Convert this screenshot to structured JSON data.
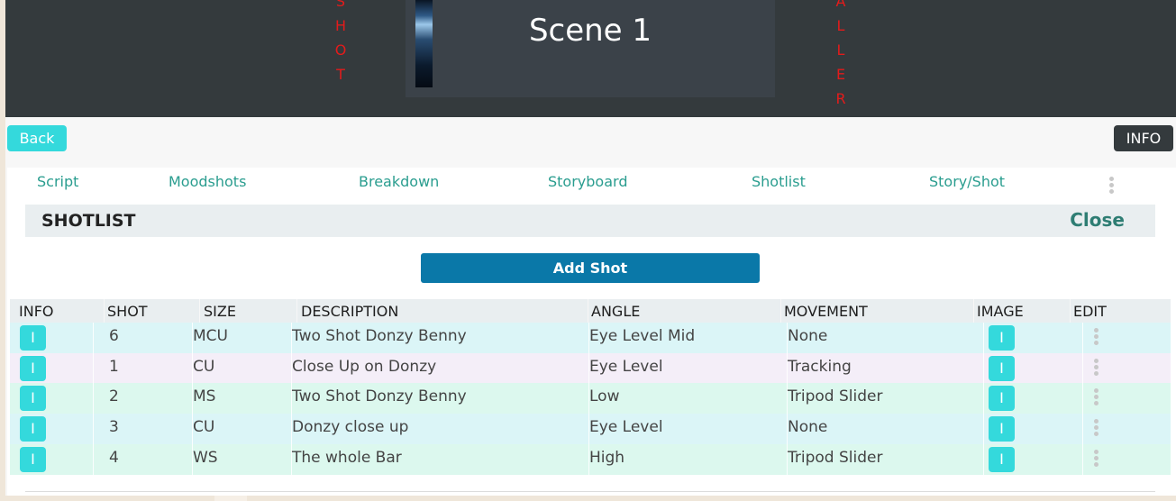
{
  "header": {
    "left_vertical": [
      "S",
      "H",
      "O",
      "T"
    ],
    "right_vertical": [
      "A",
      "L",
      "L",
      "E",
      "R"
    ],
    "scene_title": "Scene 1",
    "accent_text_color": "#e31b1b"
  },
  "toolbar": {
    "back_label": "Back",
    "info_label": "INFO"
  },
  "tabs": [
    "Script",
    "Moodshots",
    "Breakdown",
    "Storyboard",
    "Shotlist",
    "Story/Shot"
  ],
  "panel": {
    "title": "SHOTLIST",
    "close_label": "Close"
  },
  "add_shot_label": "Add Shot",
  "table": {
    "columns": [
      "INFO",
      "SHOT",
      "SIZE",
      "DESCRIPTION",
      "ANGLE",
      "MOVEMENT",
      "IMAGE",
      "EDIT"
    ],
    "info_button_label": "I",
    "image_button_label": "I",
    "rows": [
      {
        "shot": "6",
        "size": "MCU",
        "description": "Two Shot Donzy Benny",
        "angle": "Eye Level Mid",
        "movement": "None",
        "color": "#dbf5f7"
      },
      {
        "shot": "1",
        "size": "CU",
        "description": "Close Up on Donzy",
        "angle": "Eye Level",
        "movement": "Tracking",
        "color": "#f4eef8"
      },
      {
        "shot": "2",
        "size": "MS",
        "description": "Two Shot Donzy Benny",
        "angle": "Low",
        "movement": "Tripod Slider",
        "color": "#dcf8ee"
      },
      {
        "shot": "3",
        "size": "CU",
        "description": "Donzy close up",
        "angle": "Eye Level",
        "movement": "None",
        "color": "#dbf5f7"
      },
      {
        "shot": "4",
        "size": "WS",
        "description": "The whole Bar",
        "angle": "High",
        "movement": "Tripod Slider",
        "color": "#dcf8ee"
      }
    ]
  },
  "colors": {
    "accent": "#34d9dc",
    "primary": "#0a78a8",
    "dark": "#343a3d",
    "tab_text": "#2a9d8f"
  }
}
